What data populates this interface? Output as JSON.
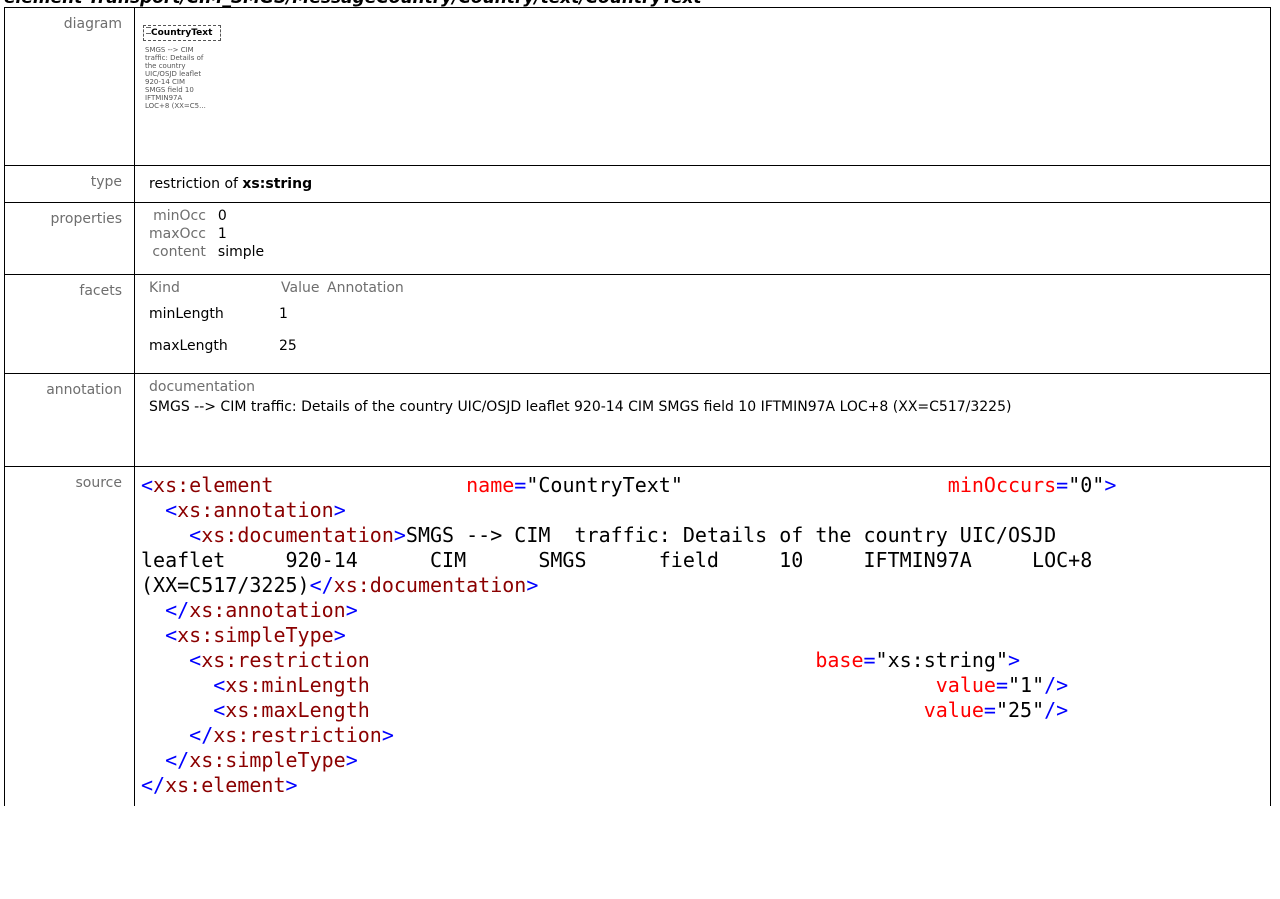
{
  "header": {
    "title": "element Transport/CIM_SMGS/MessageCountry/Country/text/CountryText"
  },
  "rows": {
    "diagram": {
      "label": "diagram",
      "element_name": "CountryText",
      "element_doc": "SMGS --> CIM\ntraffic: Details of\nthe country\nUIC/OSJD leaflet\n920-14 CIM\nSMGS field 10\nIFTMIN97A\nLOC+8 (XX=C5..."
    },
    "type": {
      "label": "type",
      "prefix": "restriction of ",
      "base": "xs:string"
    },
    "properties": {
      "label": "properties",
      "items": [
        {
          "key": "minOcc",
          "value": "0"
        },
        {
          "key": "maxOcc",
          "value": "1"
        },
        {
          "key": "content",
          "value": "simple"
        }
      ]
    },
    "facets": {
      "label": "facets",
      "headers": [
        "Kind",
        "Value",
        "Annotation"
      ],
      "items": [
        {
          "kind": "minLength",
          "value": "1"
        },
        {
          "kind": "maxLength",
          "value": "25"
        }
      ]
    },
    "annotation": {
      "label": "annotation",
      "doc_label": "documentation",
      "text": "SMGS --> CIM  traffic: Details of the country UIC/OSJD leaflet 920-14 CIM SMGS field 10 IFTMIN97A LOC+8 (XX=C517/3225)"
    },
    "source": {
      "label": "source"
    }
  },
  "colors": {
    "tag": "#8b0000",
    "punct": "#0000ff",
    "attr": "#ff0000",
    "label": "#6e6e6e"
  }
}
